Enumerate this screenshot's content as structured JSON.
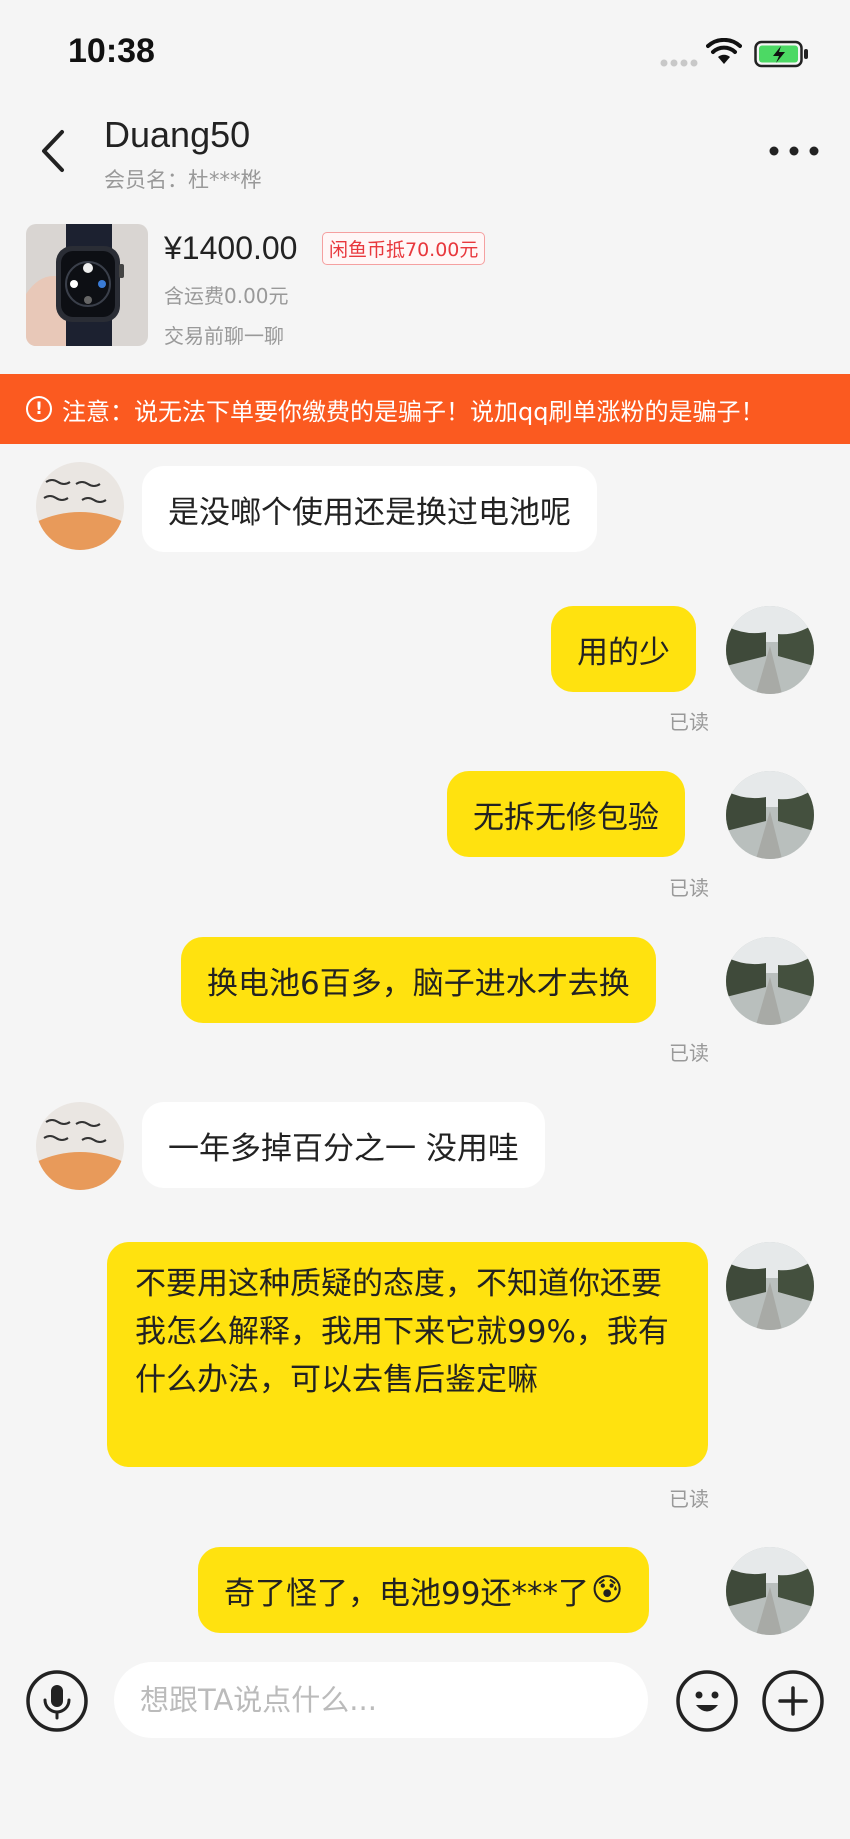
{
  "status_bar": {
    "time": "10:38"
  },
  "header": {
    "title": "Duang50",
    "member_label": "会员名：杜***桦"
  },
  "product": {
    "price": "¥1400.00",
    "coin_deduct": "闲鱼币抵70.00元",
    "shipping": "含运费0.00元",
    "chat_hint": "交易前聊一聊"
  },
  "warning": {
    "text": "注意：说无法下单要你缴费的是骗子！说加qq刷单涨粉的是骗子！"
  },
  "messages": [
    {
      "from": "other",
      "text": "是没啷个使用还是换过电池呢"
    },
    {
      "from": "me",
      "text": "用的少",
      "status": "已读"
    },
    {
      "from": "me",
      "text": "无拆无修包验",
      "status": "已读"
    },
    {
      "from": "me",
      "text": "换电池6百多，脑子进水才去换",
      "status": "已读"
    },
    {
      "from": "other",
      "text": "一年多掉百分之一 没用哇"
    },
    {
      "from": "me",
      "text": "不要用这种质疑的态度，不知道你还要我怎么解释，我用下来它就99%，我有什么办法，可以去售后鉴定嘛",
      "status": "已读"
    },
    {
      "from": "me",
      "text": "奇了怪了，电池99还***了",
      "emoji": "😰"
    }
  ],
  "input": {
    "placeholder": "想跟TA说点什么..."
  },
  "icons": {
    "back": "chevron-left-icon",
    "more": "more-dots-icon",
    "mic": "microphone-icon",
    "emoji": "emoji-icon",
    "plus": "plus-icon",
    "warning": "warning-circle-icon"
  },
  "colors": {
    "accent_bubble": "#ffe20f",
    "warning_bg": "#fb5a20",
    "price_badge": "#e8383d"
  }
}
